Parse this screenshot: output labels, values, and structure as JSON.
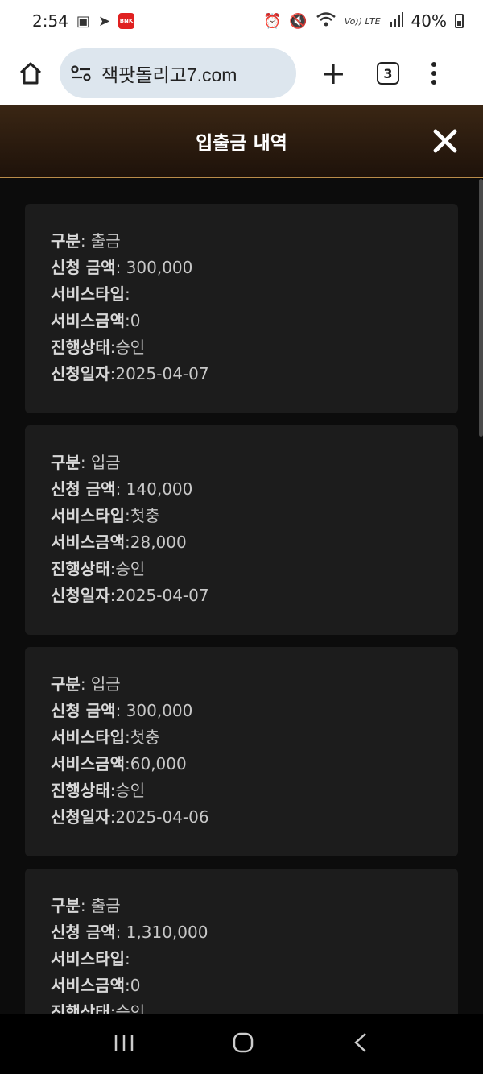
{
  "status_bar": {
    "time": "2:54",
    "network_label": "Vo)) LTE",
    "battery": "40%"
  },
  "browser": {
    "url": "잭팟돌리고7.com",
    "tab_count": "3"
  },
  "modal": {
    "title": "입출금 내역"
  },
  "labels": {
    "type": "구분",
    "amount": "신청 금액",
    "service_type": "서비스타입",
    "service_amount": "서비스금액",
    "status": "진행상태",
    "date": "신청일자"
  },
  "records": [
    {
      "type": ": 출금",
      "amount": ": 300,000",
      "service_type": ":",
      "service_amount": ":0",
      "status": ":승인",
      "date": ":2025-04-07"
    },
    {
      "type": ": 입금",
      "amount": ": 140,000",
      "service_type": ":첫충",
      "service_amount": ":28,000",
      "status": ":승인",
      "date": ":2025-04-07"
    },
    {
      "type": ": 입금",
      "amount": ": 300,000",
      "service_type": ":첫충",
      "service_amount": ":60,000",
      "status": ":승인",
      "date": ":2025-04-06"
    },
    {
      "type": ": 출금",
      "amount": ": 1,310,000",
      "service_type": ":",
      "service_amount": ":0",
      "status": ":승인",
      "date": ""
    }
  ]
}
